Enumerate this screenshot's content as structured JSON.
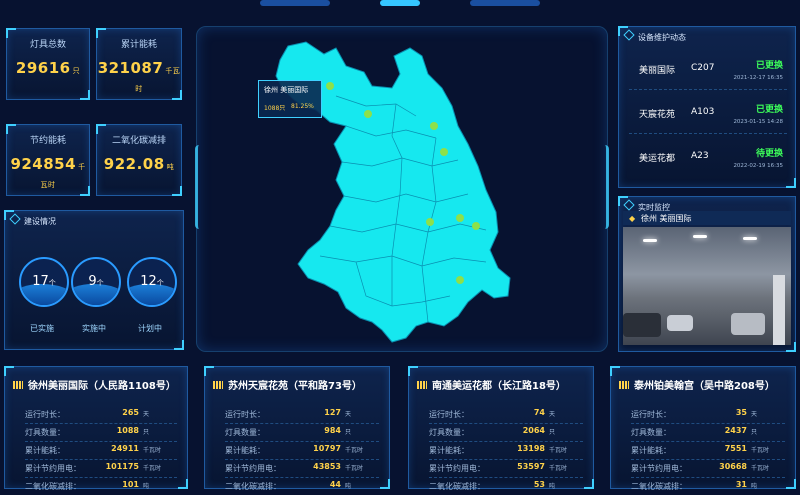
{
  "stats": [
    {
      "title": "灯具总数",
      "value": "29616",
      "unit": "只"
    },
    {
      "title": "累计能耗",
      "value": "321087",
      "unit": "千瓦时"
    },
    {
      "title": "节约能耗",
      "value": "924854",
      "unit": "千瓦时"
    },
    {
      "title": "二氧化碳减排",
      "value": "922.08",
      "unit": "吨"
    }
  ],
  "construction": {
    "title": "建设情况",
    "items": [
      {
        "value": "17",
        "unit": "个",
        "label": "已实施",
        "fill": 0.45
      },
      {
        "value": "9",
        "unit": "个",
        "label": "实施中",
        "fill": 0.45
      },
      {
        "value": "12",
        "unit": "个",
        "label": "计划中",
        "fill": 0.45
      }
    ]
  },
  "map": {
    "tooltip_title": "徐州  美丽国际",
    "tooltip_count": "1088只",
    "tooltip_pct": "81.25%"
  },
  "dynamics": {
    "title": "设备维护动态",
    "rows": [
      {
        "name": "美丽国际",
        "code": "C207",
        "status": "已更换",
        "date": "2021-12-17  16:35",
        "color": "#3dff5a"
      },
      {
        "name": "天宸花苑",
        "code": "A103",
        "status": "已更换",
        "date": "2023-01-15  14:28",
        "color": "#3dff5a"
      },
      {
        "name": "美运花都",
        "code": "A23",
        "status": "待更换",
        "date": "2022-02-19  16:35",
        "color": "#3dff5a"
      }
    ]
  },
  "video": {
    "title": "实时监控",
    "label": "徐州  美丽国际"
  },
  "sites": [
    {
      "title": "徐州美丽国际（人民路1108号）",
      "rows": [
        {
          "k": "运行时长：",
          "v": "265",
          "u": "天"
        },
        {
          "k": "灯具数量：",
          "v": "1088",
          "u": "只"
        },
        {
          "k": "累计能耗：",
          "v": "24911",
          "u": "千瓦时"
        },
        {
          "k": "累计节约用电：",
          "v": "101175",
          "u": "千瓦时"
        },
        {
          "k": "二氧化碳减排：",
          "v": "101",
          "u": "吨"
        }
      ]
    },
    {
      "title": "苏州天宸花苑（平和路73号）",
      "rows": [
        {
          "k": "运行时长：",
          "v": "127",
          "u": "天"
        },
        {
          "k": "灯具数量：",
          "v": "984",
          "u": "只"
        },
        {
          "k": "累计能耗：",
          "v": "10797",
          "u": "千瓦时"
        },
        {
          "k": "累计节约用电：",
          "v": "43853",
          "u": "千瓦时"
        },
        {
          "k": "二氧化碳减排：",
          "v": "44",
          "u": "吨"
        }
      ]
    },
    {
      "title": "南通美运花都（长江路18号）",
      "rows": [
        {
          "k": "运行时长：",
          "v": "74",
          "u": "天"
        },
        {
          "k": "灯具数量：",
          "v": "2064",
          "u": "只"
        },
        {
          "k": "累计能耗：",
          "v": "13198",
          "u": "千瓦时"
        },
        {
          "k": "累计节约用电：",
          "v": "53597",
          "u": "千瓦时"
        },
        {
          "k": "二氧化碳减排：",
          "v": "53",
          "u": "吨"
        }
      ]
    },
    {
      "title": "泰州铂美翰宫（吴中路208号）",
      "rows": [
        {
          "k": "运行时长：",
          "v": "35",
          "u": "天"
        },
        {
          "k": "灯具数量：",
          "v": "2437",
          "u": "只"
        },
        {
          "k": "累计能耗：",
          "v": "7551",
          "u": "千瓦时"
        },
        {
          "k": "累计节约用电：",
          "v": "30668",
          "u": "千瓦时"
        },
        {
          "k": "二氧化碳减排：",
          "v": "31",
          "u": "吨"
        }
      ]
    }
  ]
}
